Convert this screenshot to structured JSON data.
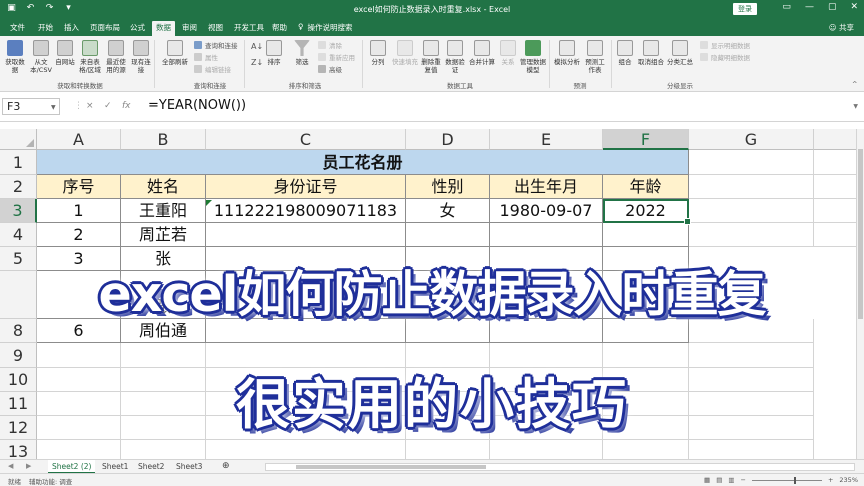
{
  "titlebar": {
    "title": "excel如何防止数据录入时重复.xlsx - Excel",
    "login": "登录",
    "qat": [
      "save-icon",
      "undo-icon",
      "redo-icon",
      "dropdown-icon"
    ],
    "window_buttons": [
      "minimize",
      "maximize",
      "close"
    ]
  },
  "tabs": {
    "items": [
      "文件",
      "开始",
      "插入",
      "页面布局",
      "公式",
      "数据",
      "审阅",
      "视图",
      "开发工具",
      "帮助"
    ],
    "active": "数据",
    "tellme": "操作说明搜索",
    "share": "共享"
  },
  "ribbon": {
    "get_transform": {
      "buttons": [
        "获取数据",
        "从文本/CSV",
        "自网站",
        "来自表格/区域",
        "最近使用的源",
        "现有连接"
      ],
      "label": "获取和转换数据"
    },
    "queries": {
      "refresh": "全部刷新",
      "small": [
        "查询和连接",
        "属性",
        "编辑链接"
      ],
      "label": "查询和连接"
    },
    "sort_filter": {
      "sort": "排序",
      "filter": "筛选",
      "small": [
        "清除",
        "重新应用",
        "高级"
      ],
      "label": "排序和筛选"
    },
    "data_tools": {
      "buttons": [
        "分列",
        "快速填充",
        "删除重复值",
        "数据验证",
        "合并计算",
        "关系",
        "管理数据模型"
      ],
      "label": "数据工具"
    },
    "forecast": {
      "buttons": [
        "模拟分析",
        "预测工作表"
      ],
      "label": "预测"
    },
    "outline": {
      "buttons": [
        "组合",
        "取消组合",
        "分类汇总"
      ],
      "small": [
        "显示明细数据",
        "隐藏明细数据"
      ],
      "label": "分级显示"
    }
  },
  "formula_bar": {
    "name_box": "F3",
    "formula": "=YEAR(NOW())",
    "buttons": [
      "×",
      "✓",
      "fx"
    ]
  },
  "columns": [
    "A",
    "B",
    "C",
    "D",
    "E",
    "F",
    "G"
  ],
  "rows": [
    "1",
    "2",
    "3",
    "4",
    "5",
    "8",
    "9",
    "10",
    "11",
    "12",
    "13"
  ],
  "table": {
    "title": "员工花名册",
    "headers": [
      "序号",
      "姓名",
      "身份证号",
      "性别",
      "出生年月",
      "年龄"
    ],
    "row3": [
      "1",
      "王重阳",
      "111222198009071183",
      "女",
      "1980-09-07",
      "2022"
    ],
    "row4": [
      "2",
      "周芷若",
      "",
      "",
      "",
      ""
    ],
    "row5": [
      "3",
      "张",
      "",
      "",
      "",
      ""
    ],
    "row7_partial": "张",
    "row8": [
      "6",
      "周伯通",
      "",
      "",
      "",
      ""
    ]
  },
  "overlay": {
    "line1": "excel如何防止数据录入时重复",
    "line2": "很实用的小技巧"
  },
  "sheet_tabs": {
    "items": [
      "Sheet2 (2)",
      "Sheet1",
      "Sheet2",
      "Sheet3"
    ],
    "active": "Sheet2 (2)",
    "add": "⊕"
  },
  "status": {
    "ready": "就绪",
    "accessibility": "辅助功能: 调查",
    "zoom": "235%"
  },
  "colors": {
    "excel_green": "#217346",
    "title_fill": "#bdd7ee",
    "header_fill": "#fff2cc",
    "overlay_outline": "#1f2f9a"
  }
}
